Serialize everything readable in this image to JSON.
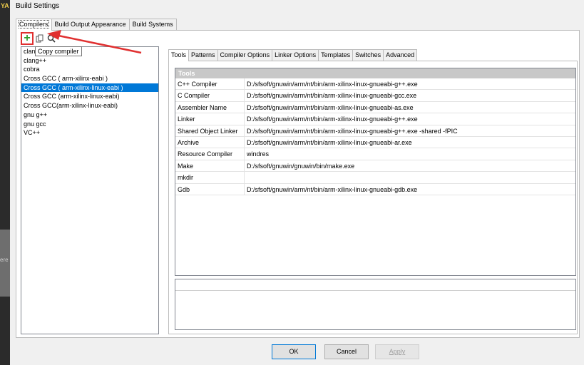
{
  "app": {
    "edge_text": "YA",
    "edge_side_text": "ere"
  },
  "window": {
    "title": "Build Settings"
  },
  "main_tabs": [
    {
      "label": "Compilers",
      "active": true
    },
    {
      "label": "Build Output Appearance",
      "active": false
    },
    {
      "label": "Build Systems",
      "active": false
    }
  ],
  "toolbar": {
    "add_icon": "plus-icon",
    "copy_icon": "copy-icon",
    "search_icon": "search-icon",
    "tooltip": "Copy compiler"
  },
  "compilers": [
    {
      "label": "clang",
      "selected": false
    },
    {
      "label": "clang++",
      "selected": false
    },
    {
      "label": "cobra",
      "selected": false
    },
    {
      "label": "Cross GCC ( arm-xilinx-eabi )",
      "selected": false
    },
    {
      "label": "Cross GCC ( arm-xilinx-linux-eabi )",
      "selected": true
    },
    {
      "label": "Cross GCC (arm-xilinx-linux-eabi)",
      "selected": false
    },
    {
      "label": "Cross GCC(arm-xilinx-linux-eabi)",
      "selected": false
    },
    {
      "label": "gnu g++",
      "selected": false
    },
    {
      "label": "gnu gcc",
      "selected": false
    },
    {
      "label": "VC++",
      "selected": false
    }
  ],
  "sub_tabs": [
    {
      "label": "Tools",
      "active": true
    },
    {
      "label": "Patterns",
      "active": false
    },
    {
      "label": "Compiler Options",
      "active": false
    },
    {
      "label": "Linker Options",
      "active": false
    },
    {
      "label": "Templates",
      "active": false
    },
    {
      "label": "Switches",
      "active": false
    },
    {
      "label": "Advanced",
      "active": false
    }
  ],
  "tools": {
    "header": "Tools",
    "rows": [
      {
        "name": "C++ Compiler",
        "value": "D:/sfsoft/gnuwin/arm/nt/bin/arm-xilinx-linux-gnueabi-g++.exe"
      },
      {
        "name": "C Compiler",
        "value": "D:/sfsoft/gnuwin/arm/nt/bin/arm-xilinx-linux-gnueabi-gcc.exe"
      },
      {
        "name": "Assembler Name",
        "value": "D:/sfsoft/gnuwin/arm/nt/bin/arm-xilinx-linux-gnueabi-as.exe"
      },
      {
        "name": "Linker",
        "value": "D:/sfsoft/gnuwin/arm/nt/bin/arm-xilinx-linux-gnueabi-g++.exe"
      },
      {
        "name": "Shared Object Linker",
        "value": "D:/sfsoft/gnuwin/arm/nt/bin/arm-xilinx-linux-gnueabi-g++.exe -shared -fPIC"
      },
      {
        "name": "Archive",
        "value": "D:/sfsoft/gnuwin/arm/nt/bin/arm-xilinx-linux-gnueabi-ar.exe"
      },
      {
        "name": "Resource Compiler",
        "value": "windres"
      },
      {
        "name": "Make",
        "value": "D:/sfsoft/gnuwin/gnuwin/bin/make.exe"
      },
      {
        "name": "mkdir",
        "value": ""
      },
      {
        "name": "Gdb",
        "value": "D:/sfsoft/gnuwin/arm/nt/bin/arm-xilinx-linux-gnueabi-gdb.exe"
      }
    ]
  },
  "buttons": {
    "ok": "OK",
    "cancel": "Cancel",
    "apply": "Apply"
  },
  "colors": {
    "selection": "#0078d7",
    "annotation": "#e03030",
    "add": "#2fa12f"
  }
}
